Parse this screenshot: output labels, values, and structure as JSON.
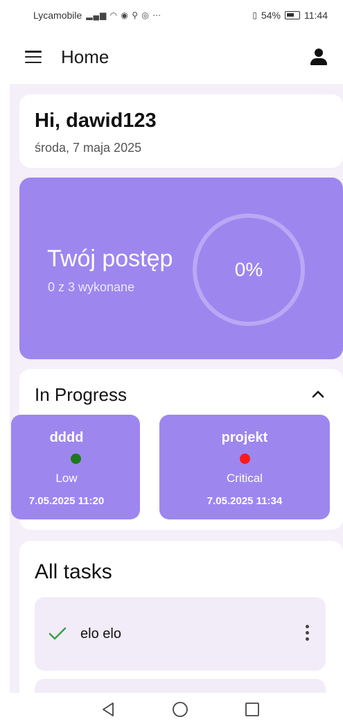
{
  "status_bar": {
    "carrier": "Lycamobile",
    "icons": "▂▄▆ ◠ ◉ ⚲ ◎ ⋯",
    "battery_percent": "54%",
    "time": "11:44"
  },
  "app_bar": {
    "title": "Home"
  },
  "greeting": {
    "title": "Hi, dawid123",
    "date": "środa, 7 maja 2025"
  },
  "progress": {
    "title": "Twój postęp",
    "subtitle": "0 z 3 wykonane",
    "percent_label": "0%",
    "value": 0
  },
  "in_progress": {
    "heading": "In Progress",
    "tasks": [
      {
        "name": "dddd",
        "priority": "Low",
        "date": "7.05.2025 11:20",
        "dot_color": "#1c7a1c"
      },
      {
        "name": "projekt",
        "priority": "Critical",
        "date": "7.05.2025 11:34",
        "dot_color": "#ff1a1a"
      }
    ]
  },
  "all_tasks": {
    "heading": "All tasks",
    "items": [
      {
        "name": "elo elo",
        "done": true
      }
    ]
  },
  "colors": {
    "accent": "#9d87ef",
    "background": "#f4eff8",
    "check": "#3aa14a"
  }
}
